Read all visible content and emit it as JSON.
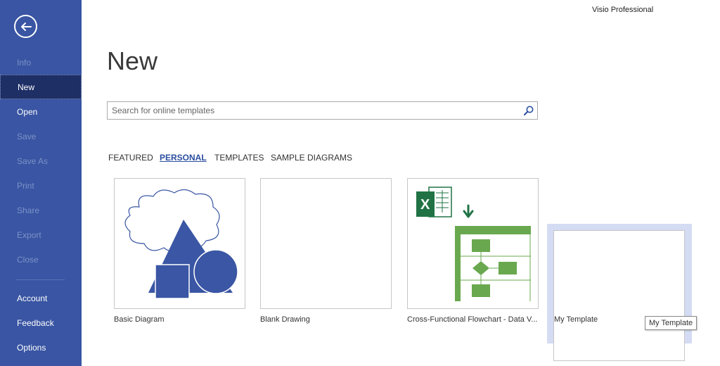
{
  "app": {
    "title": "Visio Professional"
  },
  "page": {
    "title": "New"
  },
  "sidebar": {
    "items": [
      {
        "label": "Info",
        "state": "disabled"
      },
      {
        "label": "New",
        "state": "active"
      },
      {
        "label": "Open",
        "state": "enabled"
      },
      {
        "label": "Save",
        "state": "disabled"
      },
      {
        "label": "Save As",
        "state": "disabled"
      },
      {
        "label": "Print",
        "state": "disabled"
      },
      {
        "label": "Share",
        "state": "disabled"
      },
      {
        "label": "Export",
        "state": "disabled"
      },
      {
        "label": "Close",
        "state": "disabled"
      },
      {
        "label": "Account",
        "state": "enabled"
      },
      {
        "label": "Feedback",
        "state": "enabled"
      },
      {
        "label": "Options",
        "state": "enabled"
      }
    ]
  },
  "search": {
    "placeholder": "Search for online templates",
    "value": ""
  },
  "tabs": [
    {
      "label": "FEATURED",
      "active": false
    },
    {
      "label": "PERSONAL",
      "active": true
    },
    {
      "label": "TEMPLATES",
      "active": false
    },
    {
      "label": "SAMPLE DIAGRAMS",
      "active": false
    }
  ],
  "templates": [
    {
      "label": "Basic Diagram",
      "icon": "basic-diagram-thumbnail"
    },
    {
      "label": "Blank Drawing",
      "icon": "blank-thumbnail"
    },
    {
      "label": "Cross-Functional Flowchart - Data V...",
      "icon": "excel-flowchart-thumbnail"
    },
    {
      "label": "My Template",
      "icon": "blank-thumbnail",
      "hovered": true
    }
  ],
  "tooltip": {
    "text": "My Template"
  },
  "colors": {
    "sidebar": "#3955a3",
    "sidebar_active": "#1e2f66",
    "shape_blue": "#3a56a4",
    "excel_green": "#217346",
    "flow_green": "#6aa84f",
    "hover": "#d4dcf4"
  }
}
